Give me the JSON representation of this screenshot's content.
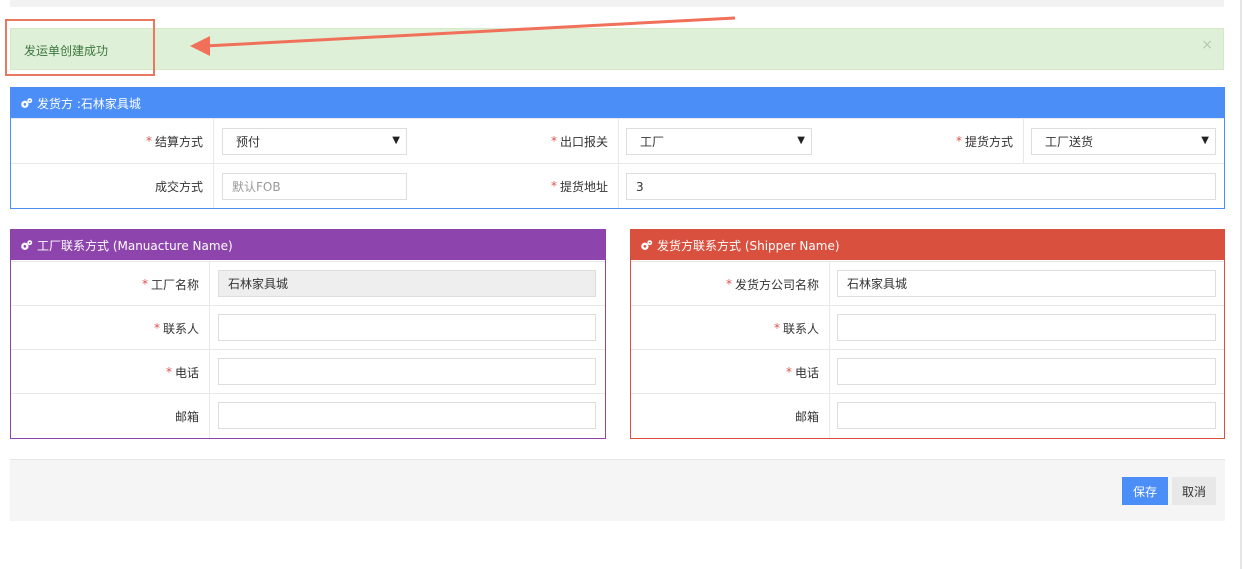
{
  "alert": {
    "message": "发运单创建成功",
    "close": "×"
  },
  "shipment": {
    "title": "发货方 :石林家具城",
    "fields": {
      "settlement": {
        "label": "结算方式",
        "value": "预付"
      },
      "export": {
        "label": "出口报关",
        "value": "工厂"
      },
      "pickup": {
        "label": "提货方式",
        "value": "工厂送货"
      },
      "deal": {
        "label": "成交方式",
        "placeholder": "默认FOB"
      },
      "address": {
        "label": "提货地址",
        "value": "3"
      }
    }
  },
  "factory": {
    "title": "工厂联系方式 (Manuacture Name)",
    "name": {
      "label": "工厂名称",
      "value": "石林家具城"
    },
    "contact": {
      "label": "联系人",
      "value": ""
    },
    "phone": {
      "label": "电话",
      "value": ""
    },
    "email": {
      "label": "邮箱",
      "value": ""
    }
  },
  "shipper": {
    "title": "发货方联系方式 (Shipper Name)",
    "company": {
      "label": "发货方公司名称",
      "value": "石林家具城"
    },
    "contact": {
      "label": "联系人",
      "value": ""
    },
    "phone": {
      "label": "电话",
      "value": ""
    },
    "email": {
      "label": "邮箱",
      "value": ""
    }
  },
  "actions": {
    "save": "保存",
    "cancel": "取消"
  },
  "colors": {
    "blue": "#4b8ef7",
    "purple": "#8e44ad",
    "red": "#d9503f",
    "success_bg": "#dff0d8"
  },
  "icons": {
    "panel": "gears-icon",
    "select": "caret-down-icon"
  }
}
